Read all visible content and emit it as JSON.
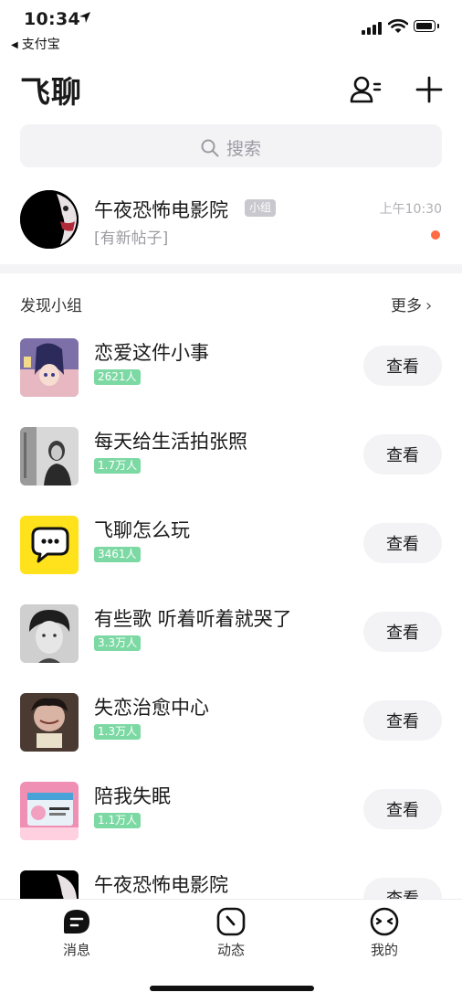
{
  "status_bar": {
    "time": "10:34",
    "back_app": "支付宝"
  },
  "header": {
    "title": "飞聊"
  },
  "search": {
    "placeholder": "搜索"
  },
  "joined_group": {
    "name": "午夜恐怖电影院",
    "tag": "小组",
    "subtitle": "[有新帖子]",
    "time": "上午10:30"
  },
  "discover": {
    "title": "发现小组",
    "more_label": "更多",
    "view_label": "查看",
    "groups": [
      {
        "name": "恋爱这件小事",
        "members": "2621人"
      },
      {
        "name": "每天给生活拍张照",
        "members": "1.7万人"
      },
      {
        "name": "飞聊怎么玩",
        "members": "3461人"
      },
      {
        "name": "有些歌 听着听着就哭了",
        "members": "3.3万人"
      },
      {
        "name": "失恋治愈中心",
        "members": "1.3万人"
      },
      {
        "name": "陪我失眠",
        "members": "1.1万人"
      },
      {
        "name": "午夜恐怖电影院",
        "members": ""
      }
    ]
  },
  "tabbar": {
    "tabs": [
      {
        "label": "消息",
        "icon": "message-icon"
      },
      {
        "label": "动态",
        "icon": "activity-icon"
      },
      {
        "label": "我的",
        "icon": "profile-icon"
      }
    ]
  },
  "colors": {
    "accent_green": "#7dd9a4",
    "unread_dot": "#ff6b45",
    "search_bg": "#f3f3f6"
  }
}
